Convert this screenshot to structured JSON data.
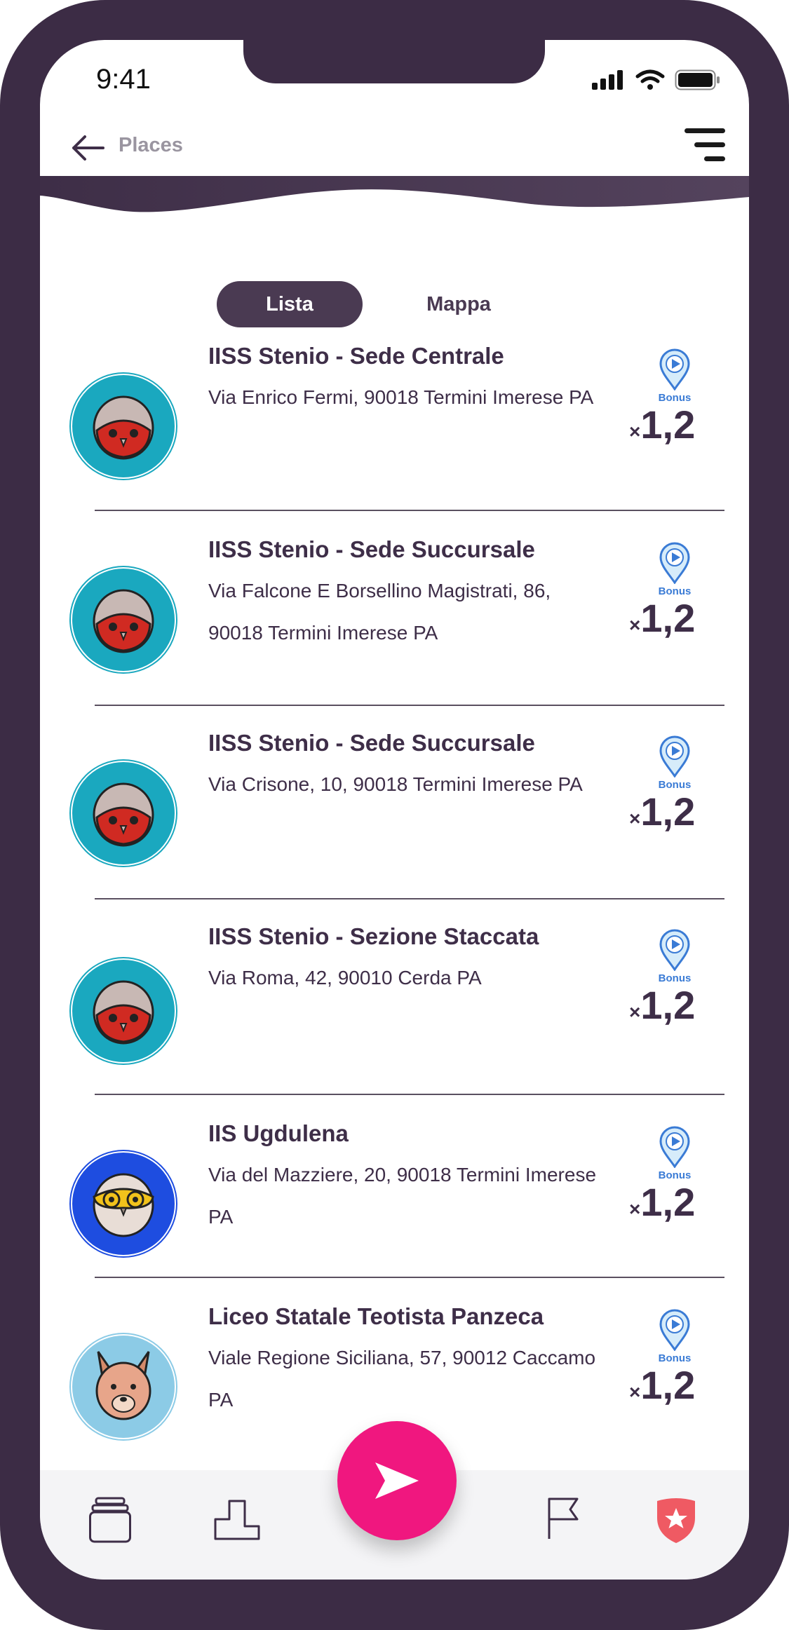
{
  "status_bar": {
    "time": "9:41"
  },
  "header": {
    "back_label": "Places"
  },
  "segments": {
    "active": "Lista",
    "inactive": "Mappa"
  },
  "places": [
    {
      "name": "IISS Stenio - Sede Centrale",
      "address": "Via Enrico Fermi, 90018 Termini Imerese PA",
      "bonus_label": "Bonus",
      "bonus_x": "×",
      "bonus_value": "1,2",
      "avatar": "red-owl"
    },
    {
      "name": "IISS Stenio - Sede Succursale",
      "address": "Via Falcone E Borsellino Magistrati, 86, 90018 Termini Imerese PA",
      "bonus_label": "Bonus",
      "bonus_x": "×",
      "bonus_value": "1,2",
      "avatar": "red-owl"
    },
    {
      "name": "IISS Stenio - Sede Succursale",
      "address": "Via Crisone, 10, 90018 Termini Imerese PA",
      "bonus_label": "Bonus",
      "bonus_x": "×",
      "bonus_value": "1,2",
      "avatar": "red-owl"
    },
    {
      "name": "IISS Stenio - Sezione Staccata",
      "address": "Via Roma, 42, 90010 Cerda PA",
      "bonus_label": "Bonus",
      "bonus_x": "×",
      "bonus_value": "1,2",
      "avatar": "red-owl"
    },
    {
      "name": "IIS Ugdulena",
      "address": "Via del Mazziere, 20, 90018 Termini Imerese PA",
      "bonus_label": "Bonus",
      "bonus_x": "×",
      "bonus_value": "1,2",
      "avatar": "yellow-owl"
    },
    {
      "name": "Liceo Statale Teotista Panzeca",
      "address": "Viale Regione Siciliana, 57, 90012 Caccamo PA",
      "bonus_label": "Bonus",
      "bonus_x": "×",
      "bonus_value": "1,2",
      "avatar": "fox"
    }
  ],
  "tabbar": {
    "icons": [
      "cards-icon",
      "podium-icon",
      "send-icon",
      "flag-icon",
      "shield-star-icon"
    ]
  },
  "colors": {
    "frame": "#3c2c45",
    "header_band": "#4a3a52",
    "text_dark": "#3e2e48",
    "fab": "#f0177f",
    "bonus_blue": "#3a7bd5",
    "avatar_teal": "#1aa8bf",
    "avatar_blue": "#1e4de0",
    "avatar_light": "#8ccbe6"
  }
}
